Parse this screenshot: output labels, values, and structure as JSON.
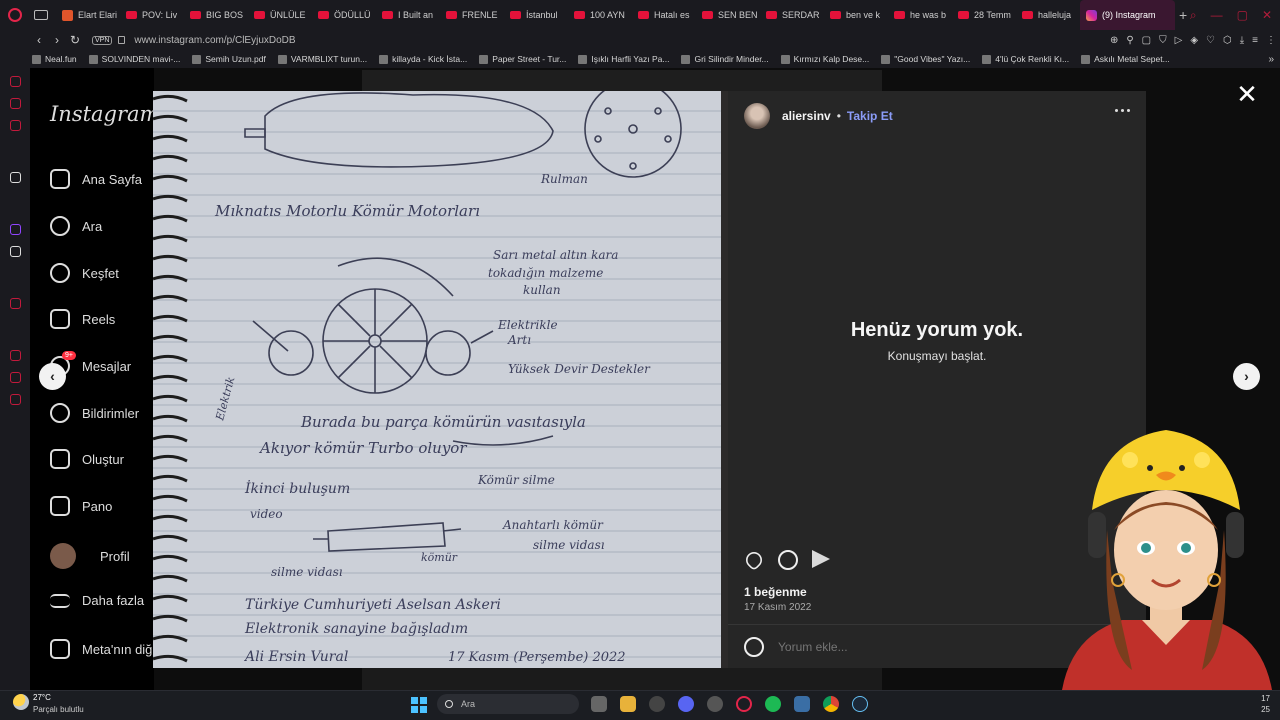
{
  "browser": {
    "tabs": [
      {
        "title": "Elart Elari",
        "type": "hb"
      },
      {
        "title": "POV: Liv",
        "type": "yt"
      },
      {
        "title": "BIG BOS",
        "type": "yt"
      },
      {
        "title": "ÜNLÜLE",
        "type": "yt"
      },
      {
        "title": "ÖDÜLLÜ",
        "type": "yt"
      },
      {
        "title": "I Built an",
        "type": "yt"
      },
      {
        "title": "FRENLE",
        "type": "yt"
      },
      {
        "title": "İstanbul",
        "type": "yt"
      },
      {
        "title": "100 AYN",
        "type": "yt"
      },
      {
        "title": "Hatalı es",
        "type": "yt"
      },
      {
        "title": "SEN BEN",
        "type": "yt"
      },
      {
        "title": "SERDAR",
        "type": "yt"
      },
      {
        "title": "ben ve k",
        "type": "yt"
      },
      {
        "title": "he was b",
        "type": "yt"
      },
      {
        "title": "28 Temm",
        "type": "yt"
      },
      {
        "title": "halleluja",
        "type": "yt"
      },
      {
        "title": "(9) Instagram",
        "type": "ig",
        "active": true
      }
    ],
    "new_tab": "+",
    "vpn_label": "VPN",
    "url": "www.instagram.com/p/ClEyjuxDoDB",
    "bookmarks": [
      "Neal.fun",
      "SOLVINDEN mavi-...",
      "Semih Uzun.pdf",
      "VARMBLIXT turun...",
      "killayda - Kick İsta...",
      "Paper Street - Tur...",
      "Işıklı Harfli Yazı Pa...",
      "Gri Silindir Minder...",
      "Kırmızı Kalp Dese...",
      "\"Good Vibes\" Yazı...",
      "4'lü Çok Renkli Kı...",
      "Askılı Metal Sepet..."
    ]
  },
  "instagram": {
    "logo": "Instagram",
    "nav": [
      {
        "label": "Ana Sayfa",
        "icon": "home-icon"
      },
      {
        "label": "Ara",
        "icon": "search-icon"
      },
      {
        "label": "Keşfet",
        "icon": "compass-icon"
      },
      {
        "label": "Reels",
        "icon": "reels-icon"
      },
      {
        "label": "Mesajlar",
        "icon": "messenger-icon"
      },
      {
        "label": "Bildirimler",
        "icon": "heart-icon"
      },
      {
        "label": "Oluştur",
        "icon": "plus-icon"
      },
      {
        "label": "Pano",
        "icon": "dashboard-icon"
      },
      {
        "label": "Profil",
        "icon": "avatar-icon"
      },
      {
        "label": "Daha fazla",
        "icon": "menu-icon"
      },
      {
        "label": "Meta'nın diğ",
        "icon": "meta-icon"
      }
    ],
    "messages_badge": "9+"
  },
  "post": {
    "username": "aliersinv",
    "separator": "•",
    "follow_label": "Takip Et",
    "no_comments_title": "Henüz yorum yok.",
    "no_comments_sub": "Konuşmayı başlat.",
    "likes": "1 beğenme",
    "date": "17 Kasım 2022",
    "comment_placeholder": "Yorum ekle...",
    "close": "✕",
    "prev": "‹",
    "next": "›",
    "notebook": {
      "lines": [
        "Rulman",
        "Mıknatıs Motorlu Kömür Motorları",
        "Sarı metal altın kara",
        "tokadığın malzeme",
        "kullan",
        "Elektrikle",
        "Artı",
        "Yüksek Devir Destekler",
        "Elektrik",
        "Burada bu parça kömürün vasıtasıyla",
        "Akıyor kömür Turbo oluyor",
        "İkinci buluşum",
        "video",
        "Kömür silme",
        "Anahtarlı kömür",
        "silme vidası",
        "silme vidası",
        "kömür",
        "Türkiye Cumhuriyeti Aselsan Askeri",
        "Elektronik sanayine bağışladım",
        "Ali Ersin Vural",
        "17 Kasım (Perşembe) 2022"
      ]
    }
  },
  "taskbar": {
    "temperature": "27°C",
    "weather": "Parçalı bulutlu",
    "search": "Ara",
    "time": "17",
    "date": "25"
  }
}
